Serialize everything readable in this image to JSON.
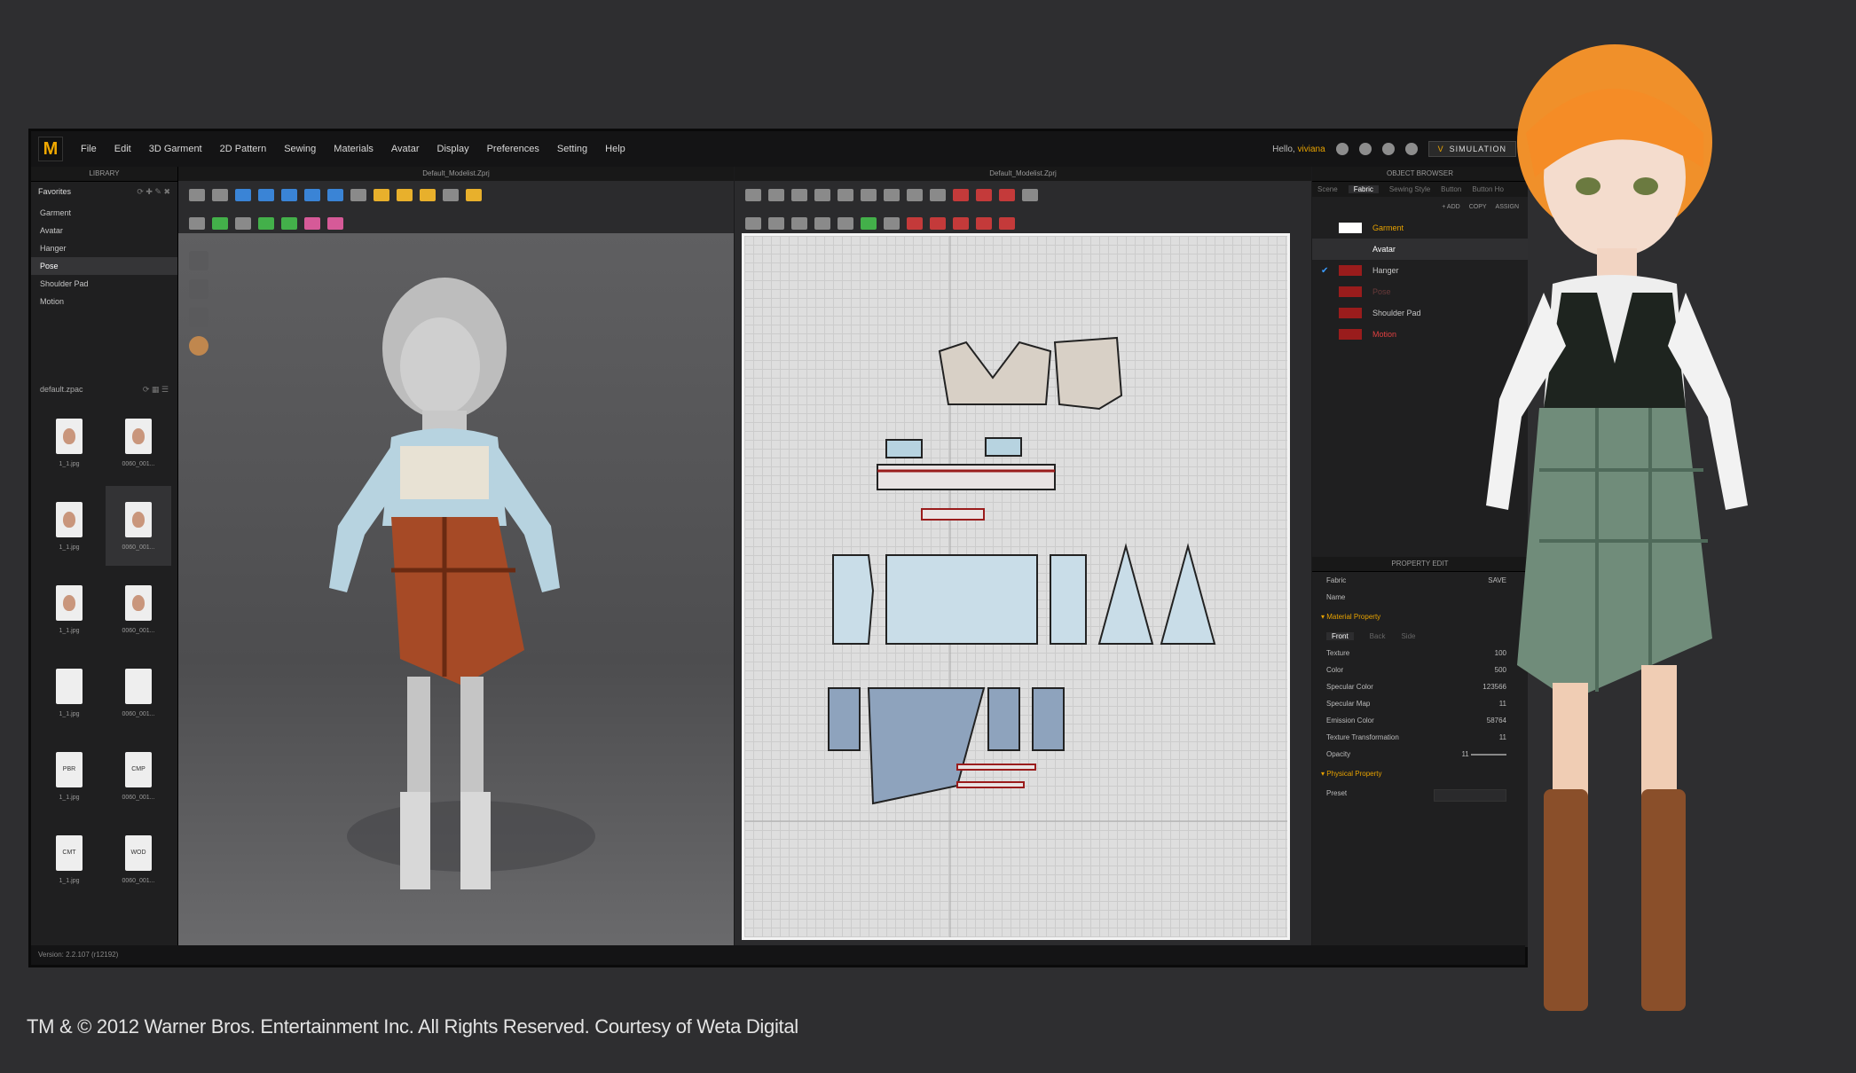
{
  "menu": {
    "logo": "M",
    "items": [
      "File",
      "Edit",
      "3D Garment",
      "2D Pattern",
      "Sewing",
      "Materials",
      "Avatar",
      "Display",
      "Preferences",
      "Setting",
      "Help"
    ],
    "hello_prefix": "Hello,",
    "user": "viviana",
    "simulation": "SIMULATION"
  },
  "library": {
    "title": "LIBRARY",
    "favorites": "Favorites",
    "items": [
      "Garment",
      "Avatar",
      "Hanger",
      "Pose",
      "Shoulder Pad",
      "Motion"
    ],
    "selected_index": 3,
    "file_header": "default.zpac",
    "thumbnails": [
      {
        "label": "1_1.jpg",
        "kind": "face"
      },
      {
        "label": "0060_001...",
        "kind": "face"
      },
      {
        "label": "1_1.jpg",
        "kind": "face"
      },
      {
        "label": "0060_001...",
        "kind": "face"
      },
      {
        "label": "1_1.jpg",
        "kind": "face"
      },
      {
        "label": "0060_001...",
        "kind": "face"
      },
      {
        "label": "1_1.jpg",
        "kind": "doc"
      },
      {
        "label": "0060_001...",
        "kind": "doc"
      },
      {
        "label": "1_1.jpg",
        "kind": "PBR"
      },
      {
        "label": "0060_001...",
        "kind": "CMP"
      },
      {
        "label": "1_1.jpg",
        "kind": "CMT"
      },
      {
        "label": "0060_001...",
        "kind": "WOD"
      }
    ]
  },
  "viewport3d": {
    "title": "Default_Modelist.Zprj"
  },
  "viewport2d": {
    "title": "Default_Modelist.Zprj"
  },
  "object_browser": {
    "title": "OBJECT BROWSER",
    "tabs": [
      "Scene",
      "Fabric",
      "Sewing Style",
      "Button",
      "Button Ho"
    ],
    "active_tab": "Fabric",
    "actions": [
      "+ ADD",
      "COPY",
      "ASSIGN"
    ],
    "fabrics": [
      {
        "name": "Garment",
        "color": "#ffffff",
        "label_color": "#e7a200",
        "selected": false
      },
      {
        "name": "Avatar",
        "color": "",
        "label_color": "#ffffff",
        "selected": true
      },
      {
        "name": "Hanger",
        "color": "#9a1c1c",
        "label_color": "#c6c6c6",
        "checked": true
      },
      {
        "name": "Pose",
        "color": "#9a1c1c",
        "label_color": "#6a3a3a"
      },
      {
        "name": "Shoulder Pad",
        "color": "#9a1c1c",
        "label_color": "#c6c6c6"
      },
      {
        "name": "Motion",
        "color": "#9a1c1c",
        "label_color": "#e04040"
      }
    ]
  },
  "property_editor": {
    "title": "PROPERTY EDIT",
    "save": "SAVE",
    "fabric_label": "Fabric",
    "name_label": "Name",
    "material_section": "Material Property",
    "faces": [
      "Front",
      "Back",
      "Side"
    ],
    "rows": [
      {
        "label": "Texture",
        "value": "100"
      },
      {
        "label": "Color",
        "value": "500"
      },
      {
        "label": "Specular Color",
        "value": "123566"
      },
      {
        "label": "Specular Map",
        "value": "11"
      },
      {
        "label": "Emission Color",
        "value": "58764"
      },
      {
        "label": "Texture Transformation",
        "value": "11"
      }
    ],
    "opacity_label": "Opacity",
    "opacity_value": "11",
    "physical_section": "Physical Property",
    "preset_label": "Preset"
  },
  "status": {
    "version": "Version: 2.2.107 (r12192)"
  },
  "copyright": "TM & © 2012 Warner Bros. Entertainment Inc. All Rights Reserved. Courtesy of Weta Digital"
}
